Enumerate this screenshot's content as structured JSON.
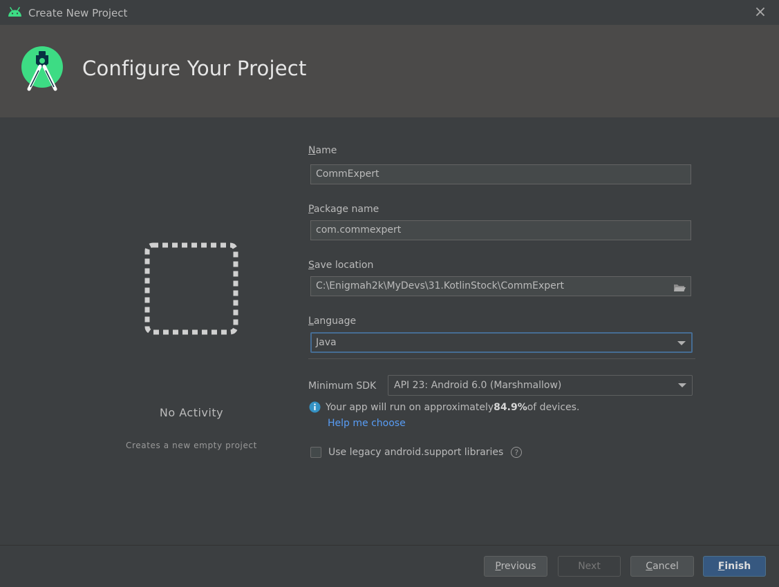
{
  "window": {
    "title": "Create New Project"
  },
  "header": {
    "heading": "Configure Your Project"
  },
  "template": {
    "name": "No Activity",
    "description": "Creates a new empty project"
  },
  "form": {
    "name": {
      "label_mnemonic": "N",
      "label_rest": "ame",
      "value": "CommExpert"
    },
    "package": {
      "label_mnemonic": "P",
      "label_rest": "ackage name",
      "value": "com.commexpert"
    },
    "save_location": {
      "label_mnemonic": "S",
      "label_rest": "ave location",
      "value": "C:\\Enigmah2k\\MyDevs\\31.KotlinStock\\CommExpert"
    },
    "language": {
      "label_mnemonic": "L",
      "label_rest": "anguage",
      "value": "Java"
    },
    "min_sdk": {
      "label": "Minimum SDK",
      "value": "API 23: Android 6.0 (Marshmallow)"
    },
    "info": {
      "prefix": "Your app will run on approximately ",
      "percent": "84.9%",
      "suffix": " of devices."
    },
    "help_link": "Help me choose",
    "legacy": {
      "label": "Use legacy android.support libraries",
      "checked": false
    }
  },
  "buttons": {
    "previous": {
      "mnemonic": "P",
      "rest": "revious"
    },
    "next": "Next",
    "cancel": {
      "mnemonic": "C",
      "rest": "ancel"
    },
    "finish": {
      "mnemonic": "F",
      "rest": "inish"
    }
  },
  "colors": {
    "background": "#3c3f41",
    "header": "#4b4a49",
    "accent_focus": "#466d94",
    "link": "#589df6",
    "android_green": "#3ddc84",
    "primary_button": "#365880"
  },
  "icons": {
    "app": "android-icon",
    "logo": "android-studio-logo",
    "close": "close-icon",
    "folder": "folder-icon",
    "info": "info-icon",
    "help": "question-icon",
    "dropdown": "chevron-down-icon"
  }
}
